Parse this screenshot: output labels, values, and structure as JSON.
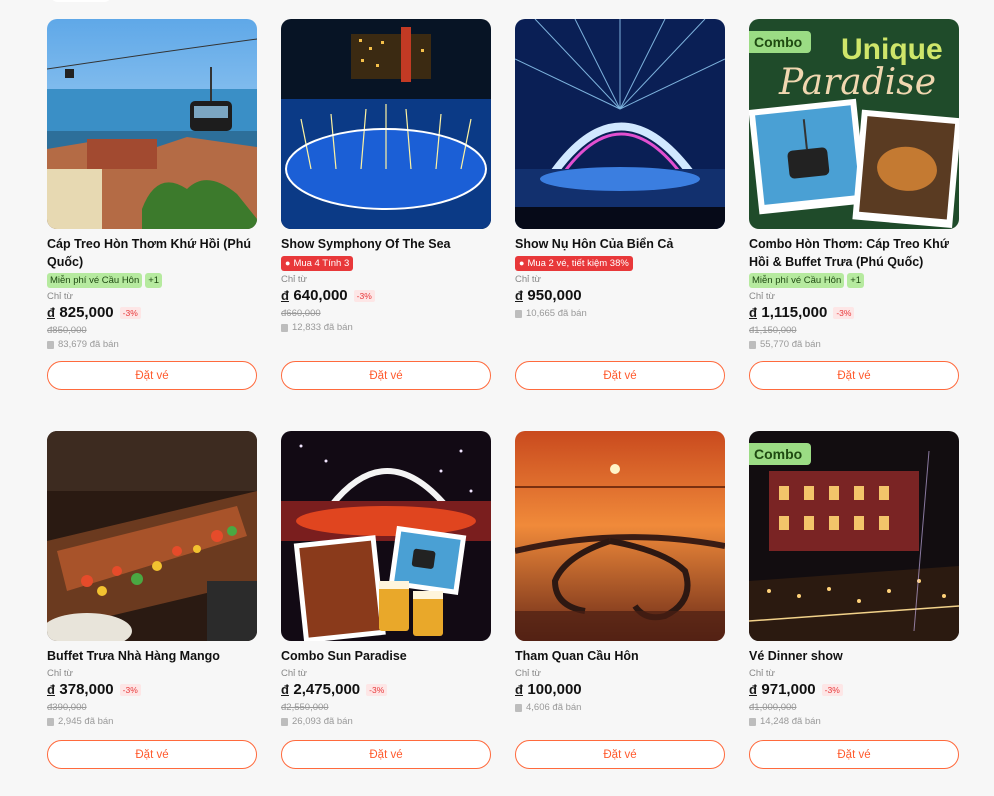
{
  "colors": {
    "accent": "#ff5a2d",
    "promo": "#e8383a",
    "tag_bg": "#b6ea9f",
    "combo_bg": "#9bdc84"
  },
  "labels": {
    "from": "Chỉ từ",
    "book": "Đặt vé",
    "currency": "đ",
    "sold_icon": "shopping-bag-icon"
  },
  "products": [
    {
      "title": "Cáp Treo Hòn Thơm Khứ Hồi (Phú Quốc)",
      "tags": [
        "Miễn phí vé Cầu Hôn",
        "+1"
      ],
      "price": "825,000",
      "discount": "-3%",
      "old_price": "850,000",
      "sold": "83,679 đã bán"
    },
    {
      "title": "Show Symphony Of The Sea",
      "promo": "Mua 4 Tính 3",
      "price": "640,000",
      "discount": "-3%",
      "old_price": "660,000",
      "sold": "12,833 đã bán"
    },
    {
      "title": "Show Nụ Hôn Của Biển Cả",
      "promo": "Mua 2 vé, tiết kiệm 38%",
      "price": "950,000",
      "sold": "10,665 đã bán"
    },
    {
      "title": "Combo Hòn Thơm: Cáp Treo Khứ Hồi & Buffet Trưa (Phú Quốc)",
      "badge": "Combo",
      "image_text": [
        "Unique",
        "Paradise"
      ],
      "tags": [
        "Miễn phí vé Cầu Hôn",
        "+1"
      ],
      "price": "1,115,000",
      "discount": "-3%",
      "old_price": "1,150,000",
      "sold": "55,770 đã bán"
    },
    {
      "title": "Buffet Trưa Nhà Hàng Mango",
      "price": "378,000",
      "discount": "-3%",
      "old_price": "390,000",
      "sold": "2,945 đã bán"
    },
    {
      "title": "Combo Sun Paradise",
      "price": "2,475,000",
      "discount": "-3%",
      "old_price": "2,550,000",
      "sold": "26,093 đã bán"
    },
    {
      "title": "Tham Quan Cầu Hôn",
      "price": "100,000",
      "sold": "4,606 đã bán"
    },
    {
      "title": "Vé Dinner show",
      "badge": "Combo",
      "price": "971,000",
      "discount": "-3%",
      "old_price": "1,000,000",
      "sold": "14,248 đã bán"
    }
  ]
}
